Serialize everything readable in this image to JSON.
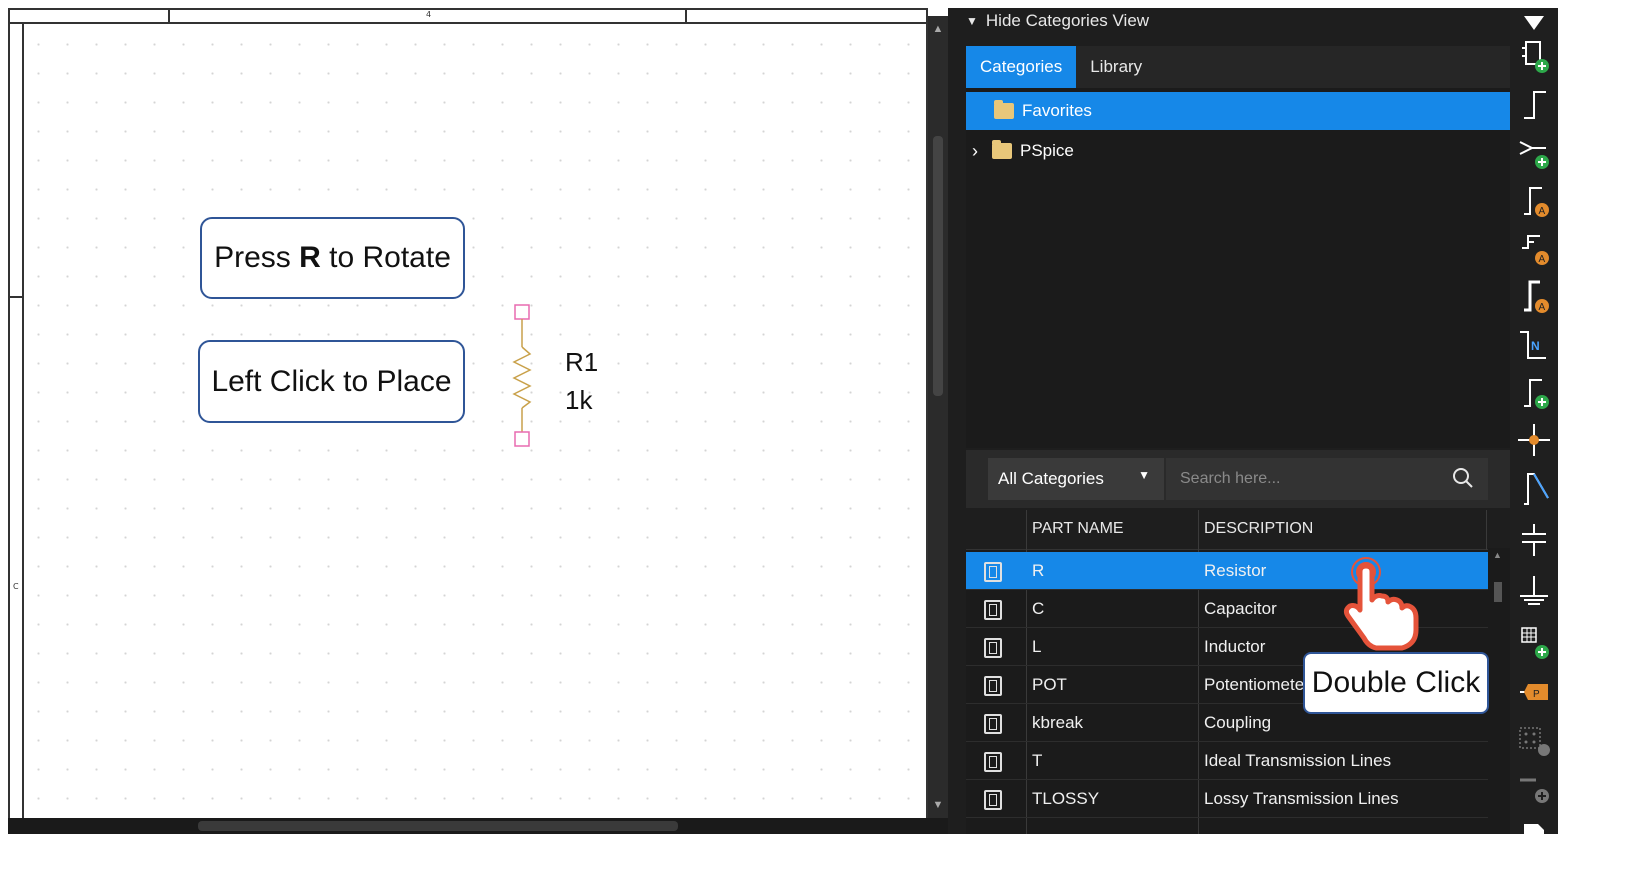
{
  "canvas": {
    "ruler_top_label": "4",
    "ruler_left_label": "C",
    "callout_rotate": {
      "pre": "Press ",
      "key": "R",
      "post": " to Rotate"
    },
    "callout_place": "Left Click to Place",
    "part": {
      "refdes": "R1",
      "value": "1k"
    }
  },
  "panel": {
    "header": "Hide Categories View",
    "tabs": [
      {
        "label": "Categories",
        "active": true
      },
      {
        "label": "Library",
        "active": false
      }
    ],
    "tree": [
      {
        "label": "Favorites",
        "selected": true,
        "expandable": false
      },
      {
        "label": "PSpice",
        "selected": false,
        "expandable": true
      }
    ],
    "category_select": "All Categories",
    "search_placeholder": "Search here...",
    "columns": {
      "part_name": "PART NAME",
      "description": "DESCRIPTION"
    },
    "rows": [
      {
        "part": "R",
        "description": "Resistor",
        "selected": true
      },
      {
        "part": "C",
        "description": "Capacitor",
        "selected": false
      },
      {
        "part": "L",
        "description": "Inductor",
        "selected": false
      },
      {
        "part": "POT",
        "description": "Potentiometer",
        "selected": false
      },
      {
        "part": "kbreak",
        "description": "Coupling",
        "selected": false
      },
      {
        "part": "T",
        "description": "Ideal Transmission Lines",
        "selected": false
      },
      {
        "part": "TLOSSY",
        "description": "Lossy Transmission Lines",
        "selected": false
      }
    ]
  },
  "annotation": {
    "double_click": "Double Click"
  },
  "toolbar_icons": [
    "place-part-icon",
    "place-wire-icon",
    "place-net-icon",
    "place-net-alias-icon",
    "place-bus-icon",
    "place-bus-entry-icon",
    "net-name-icon",
    "place-port-icon",
    "junction-icon",
    "place-pin-icon",
    "power-icon",
    "ground-icon",
    "place-block-icon",
    "offpage-connector-icon",
    "place-grid-icon",
    "place-no-connect-icon",
    "place-text-icon"
  ],
  "colors": {
    "accent": "#1688e8",
    "callout_border": "#2f5597",
    "pin": "#e86bb0",
    "resistor": "#c9a14a"
  }
}
